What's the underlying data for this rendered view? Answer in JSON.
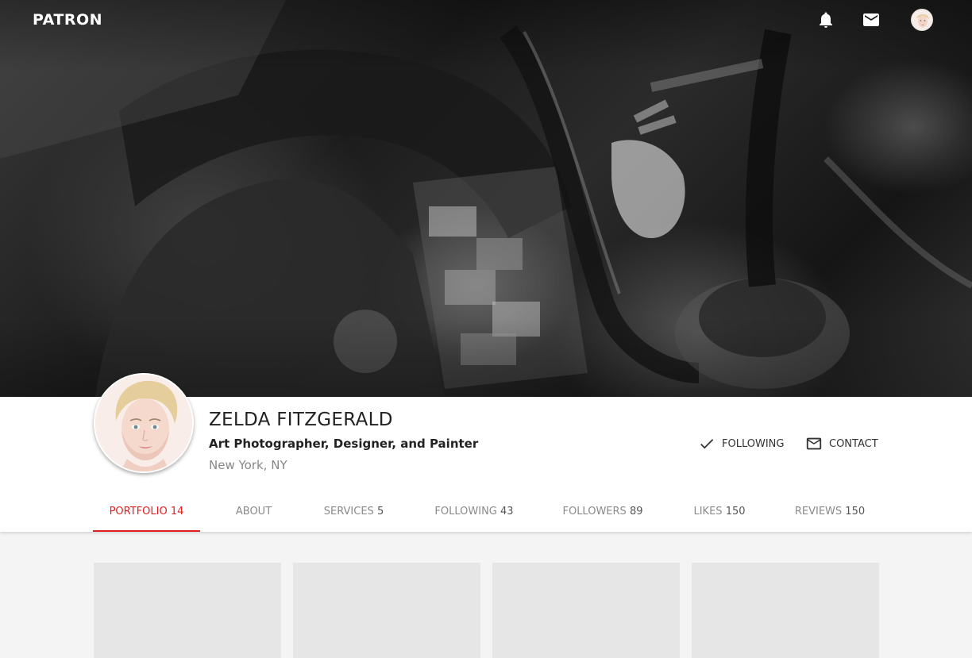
{
  "brand": "PATRON",
  "nav": {
    "notifications_icon": "bell-icon",
    "messages_icon": "mail-icon",
    "user_avatar": "user-avatar"
  },
  "profile": {
    "name": "ZELDA FITZGERALD",
    "headline": "Art Photographer, Designer, and Painter",
    "location": "New York, NY"
  },
  "actions": {
    "following_label": "FOLLOWING",
    "following_icon": "check-icon",
    "contact_label": "CONTACT",
    "contact_icon": "mail-outline-icon"
  },
  "tabs": [
    {
      "label": "PORTFOLIO",
      "count": "14",
      "active": true
    },
    {
      "label": "ABOUT",
      "count": "",
      "active": false
    },
    {
      "label": "SERVICES",
      "count": "5",
      "active": false
    },
    {
      "label": "FOLLOWING",
      "count": "43",
      "active": false
    },
    {
      "label": "FOLLOWERS",
      "count": "89",
      "active": false
    },
    {
      "label": "LIKES",
      "count": "150",
      "active": false
    },
    {
      "label": "REVIEWS",
      "count": "150",
      "active": false
    }
  ],
  "portfolio_placeholders": 4,
  "colors": {
    "accent": "#e02020",
    "panel": "#ffffff",
    "background": "#f4f4f4",
    "placeholder": "#e6e6e6"
  }
}
